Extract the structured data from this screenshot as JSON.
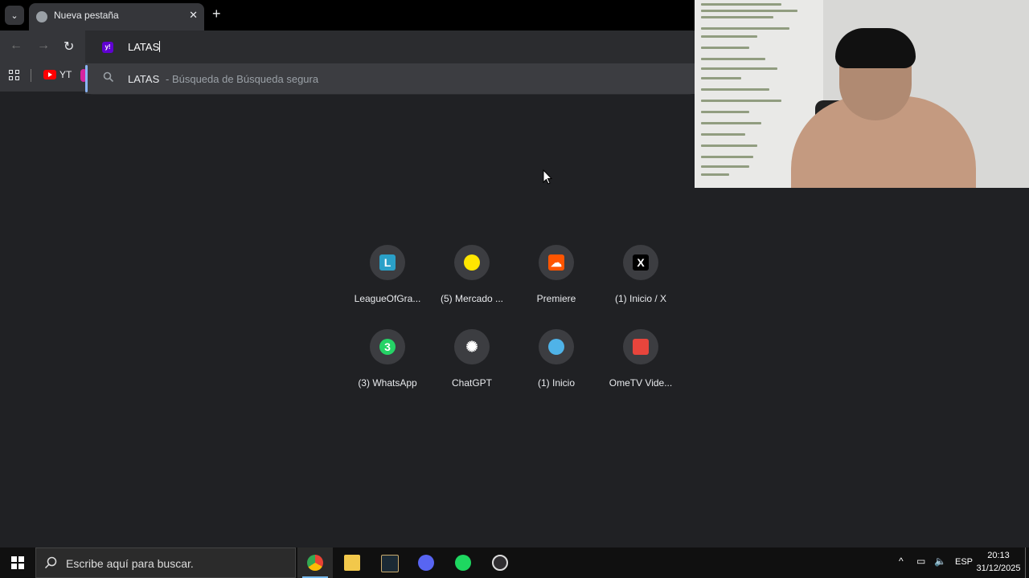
{
  "browser": {
    "tab": {
      "title": "Nueva pestaña"
    },
    "omnibox": {
      "text": "LATAS",
      "engine_badge": "y!",
      "suggestion": {
        "query": "LATAS",
        "description": " - Búsqueda de Búsqueda segura"
      }
    },
    "bookmarks": [
      {
        "label": "YT"
      }
    ]
  },
  "shortcuts": [
    {
      "label": "LeagueOfGra...",
      "glyph": "L",
      "color": "#2aa0c8"
    },
    {
      "label": "(5) Mercado ...",
      "glyph": "",
      "color": "#ffe600"
    },
    {
      "label": "Premiere",
      "glyph": "",
      "color": "#ff5500"
    },
    {
      "label": "(1) Inicio / X",
      "glyph": "X",
      "color": "#000000"
    },
    {
      "label": "(3) WhatsApp",
      "glyph": "3",
      "color": "#25d366"
    },
    {
      "label": "ChatGPT",
      "glyph": "",
      "color": "#ffffff"
    },
    {
      "label": "(1) Inicio",
      "glyph": "",
      "color": "#4fb3e8"
    },
    {
      "label": "OmeTV Vide...",
      "glyph": "",
      "color": "#e8453c"
    }
  ],
  "taskbar": {
    "search_placeholder": "Escribe aquí para buscar.",
    "language": "ESP",
    "time": "20:13",
    "date": "31/12/2025"
  }
}
